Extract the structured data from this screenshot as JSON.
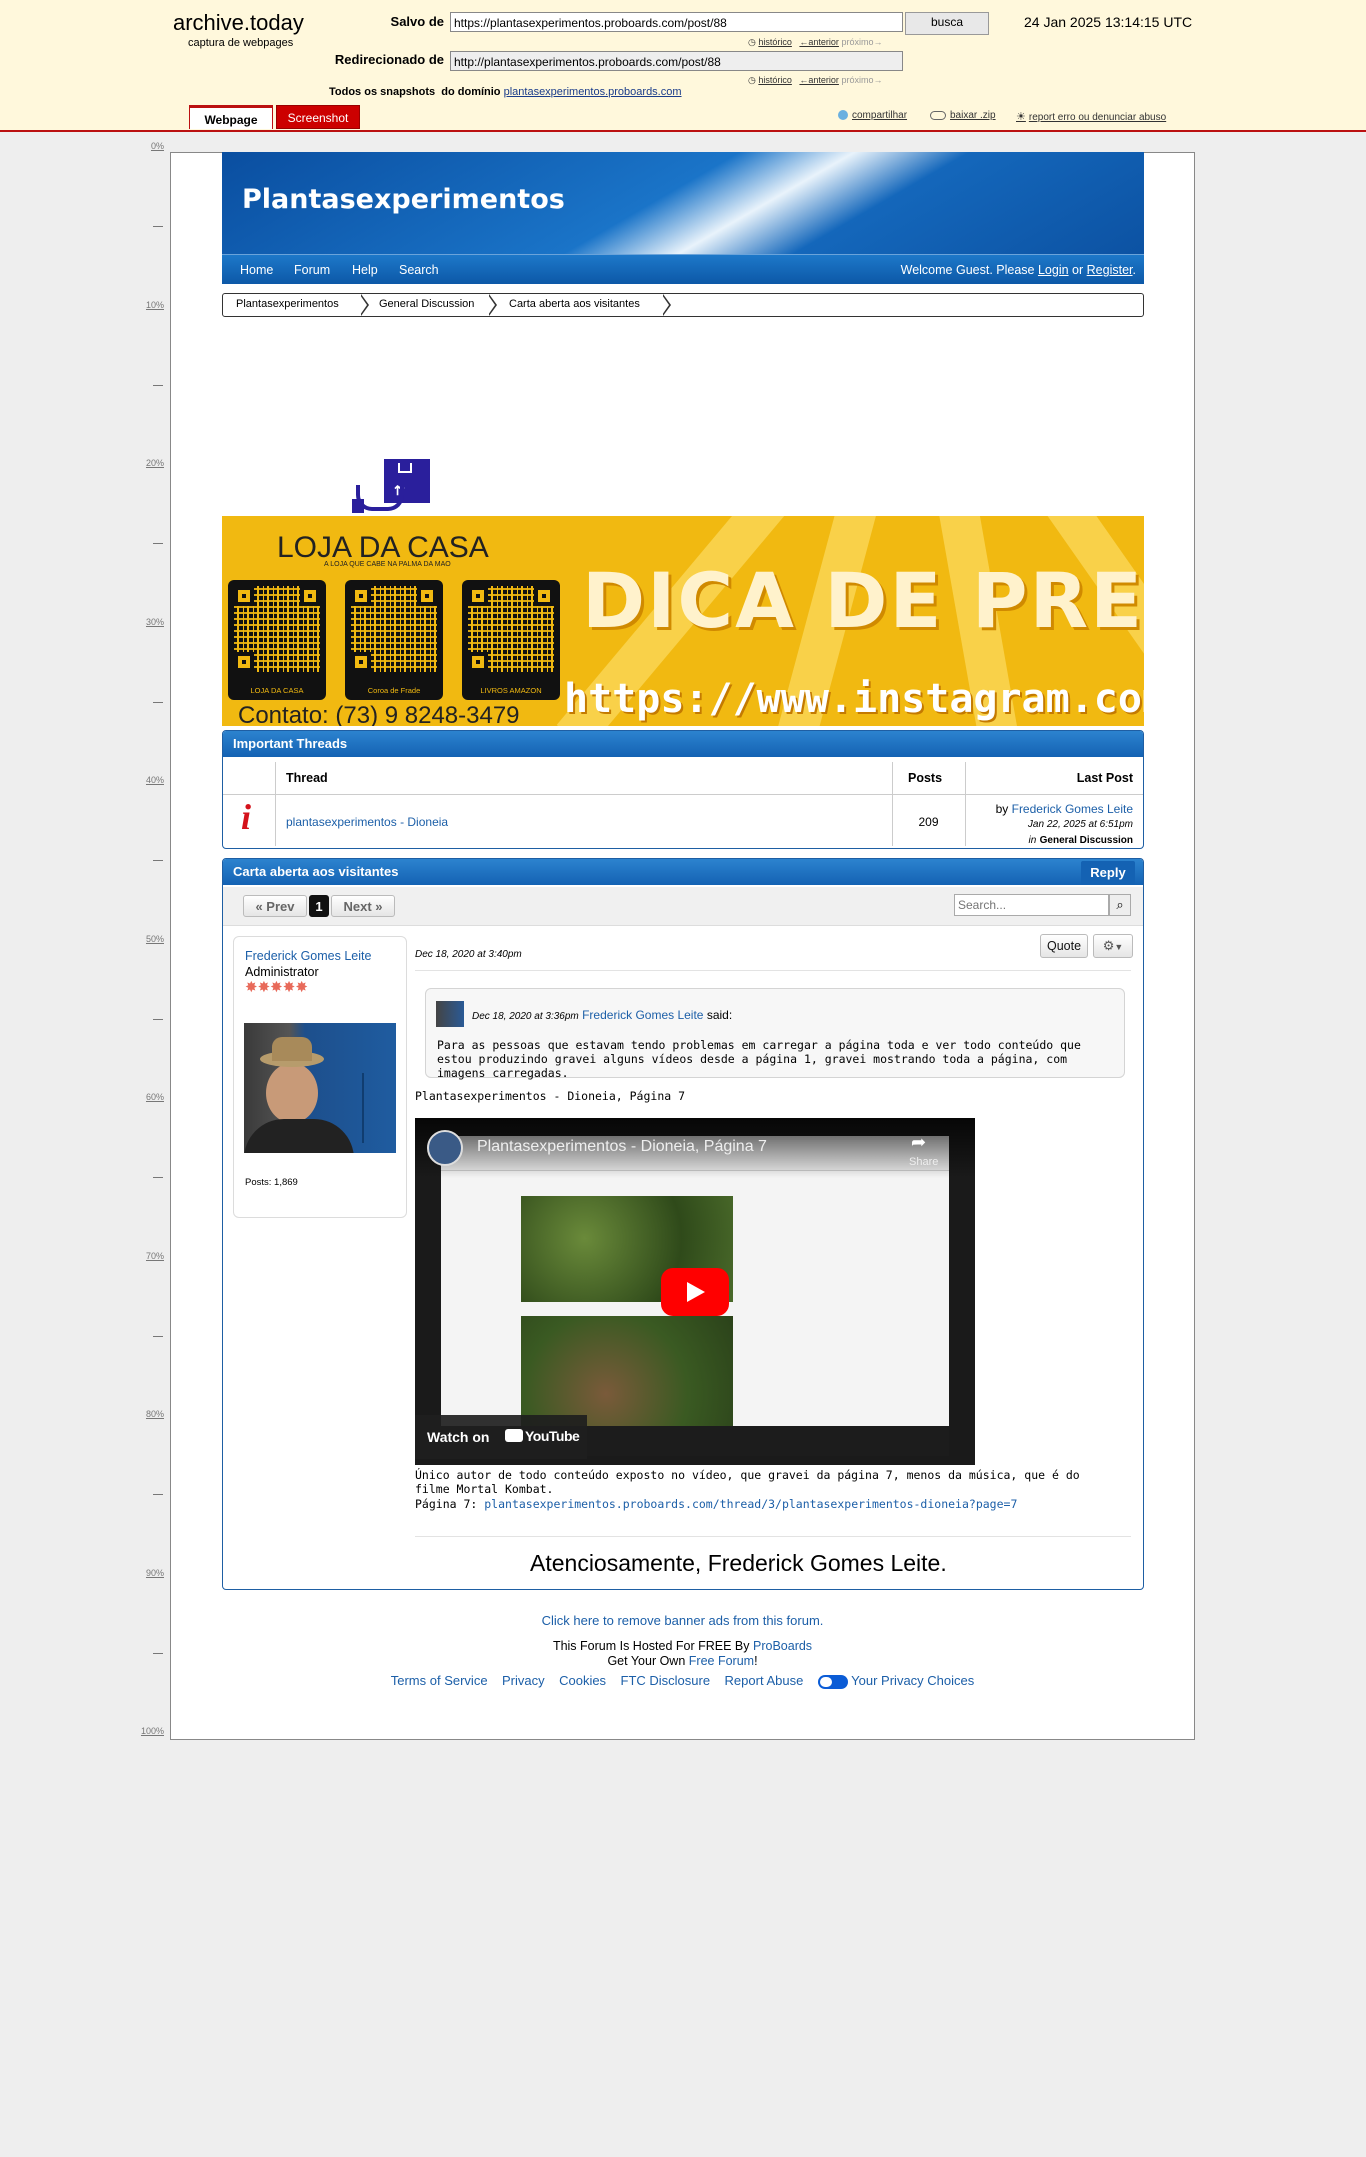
{
  "archive": {
    "site_name": "archive.today",
    "tagline": "captura de webpages",
    "saved_label": "Salvo de",
    "saved_url": "https://plantasexperimentos.proboards.com/post/88",
    "search_button": "busca",
    "timestamp": "24 Jan 2025 13:14:15 UTC",
    "history_label": "histórico",
    "prev_label": "←anterior",
    "next_label": "próximo→",
    "redirect_label": "Redirecionado de",
    "redirect_url": "http://plantasexperimentos.proboards.com/post/88",
    "all_snapshots_label": "Todos os snapshots",
    "from_domain_label": "do domínio",
    "domain": "plantasexperimentos.proboards.com",
    "tabs": {
      "webpage": "Webpage",
      "screenshot": "Screenshot"
    },
    "tools": {
      "share": "compartilhar",
      "download": "baixar .zip",
      "report": "report erro ou denunciar abuso"
    },
    "ruler": [
      "0%",
      "10%",
      "20%",
      "30%",
      "40%",
      "50%",
      "60%",
      "70%",
      "80%",
      "90%",
      "100%"
    ]
  },
  "forum": {
    "title": "Plantasexperimentos",
    "nav": [
      "Home",
      "Forum",
      "Help",
      "Search"
    ],
    "welcome_prefix": "Welcome Guest. Please",
    "login": "Login",
    "or": "or",
    "register": "Register",
    "breadcrumb": [
      "Plantasexperimentos",
      "General Discussion",
      "Carta aberta aos visitantes"
    ]
  },
  "ad": {
    "brand": "LOJA DA CASA",
    "brand_tag": "A LOJA QUE CABE NA PALMA DA MAO",
    "qr_labels": [
      "LOJA DA CASA",
      "Coroa de Frade",
      "LIVROS AMAZON"
    ],
    "headline": "DICA DE PRESENTE",
    "url": "https://www.instagram.com/lo",
    "contact": "Contato: (73) 9 8248-3479"
  },
  "important": {
    "heading": "Important Threads",
    "columns": {
      "thread": "Thread",
      "posts": "Posts",
      "last_post": "Last Post"
    },
    "row": {
      "icon": "i",
      "title": "plantasexperimentos - Dioneia",
      "posts": "209",
      "by": "by",
      "author": "Frederick Gomes Leite",
      "date": "Jan 22, 2025 at 6:51pm",
      "in": "in",
      "board": "General Discussion"
    }
  },
  "thread": {
    "heading": "Carta aberta aos visitantes",
    "reply": "Reply",
    "prev": "« Prev",
    "page": "1",
    "next": "Next »",
    "search_placeholder": "Search...",
    "post": {
      "author": "Frederick Gomes Leite",
      "role": "Administrator",
      "posts_label": "Posts: 1,869",
      "date": "Dec 18, 2020 at 3:40pm",
      "quote_btn": "Quote",
      "quote_date": "Dec 18, 2020 at 3:36pm",
      "quote_author": "Frederick Gomes Leite",
      "quote_said": "said:",
      "quote_text": "Para as pessoas que estavam tendo problemas em carregar a página toda e ver todo conteúdo que estou produzindo gravei alguns vídeos desde a página 1, gravei mostrando toda a página, com imagens carregadas.",
      "line1": "Plantasexperimentos - Dioneia, Página 7",
      "video_title": "Plantasexperimentos - Dioneia, Página 7",
      "video_share": "Share",
      "video_watch": "Watch on",
      "video_brand": "YouTube",
      "after_video": "Único autor de todo conteúdo exposto no vídeo, que gravei da página 7, menos da música, que é do filme Mortal Kombat.",
      "page7_label": "Página 7:",
      "page7_link": "plantasexperimentos.proboards.com/thread/3/plantasexperimentos-dioneia?page=7",
      "signature": "Atenciosamente, Frederick Gomes Leite."
    }
  },
  "footer": {
    "remove_ads": "Click here to remove banner ads from this forum.",
    "hosted_prefix": "This Forum Is Hosted For FREE By",
    "hosted_link": "ProBoards",
    "get_prefix": "Get Your Own",
    "get_link": "Free Forum",
    "get_suffix": "!",
    "links": [
      "Terms of Service",
      "Privacy",
      "Cookies",
      "FTC Disclosure",
      "Report Abuse",
      "Your Privacy Choices"
    ]
  }
}
